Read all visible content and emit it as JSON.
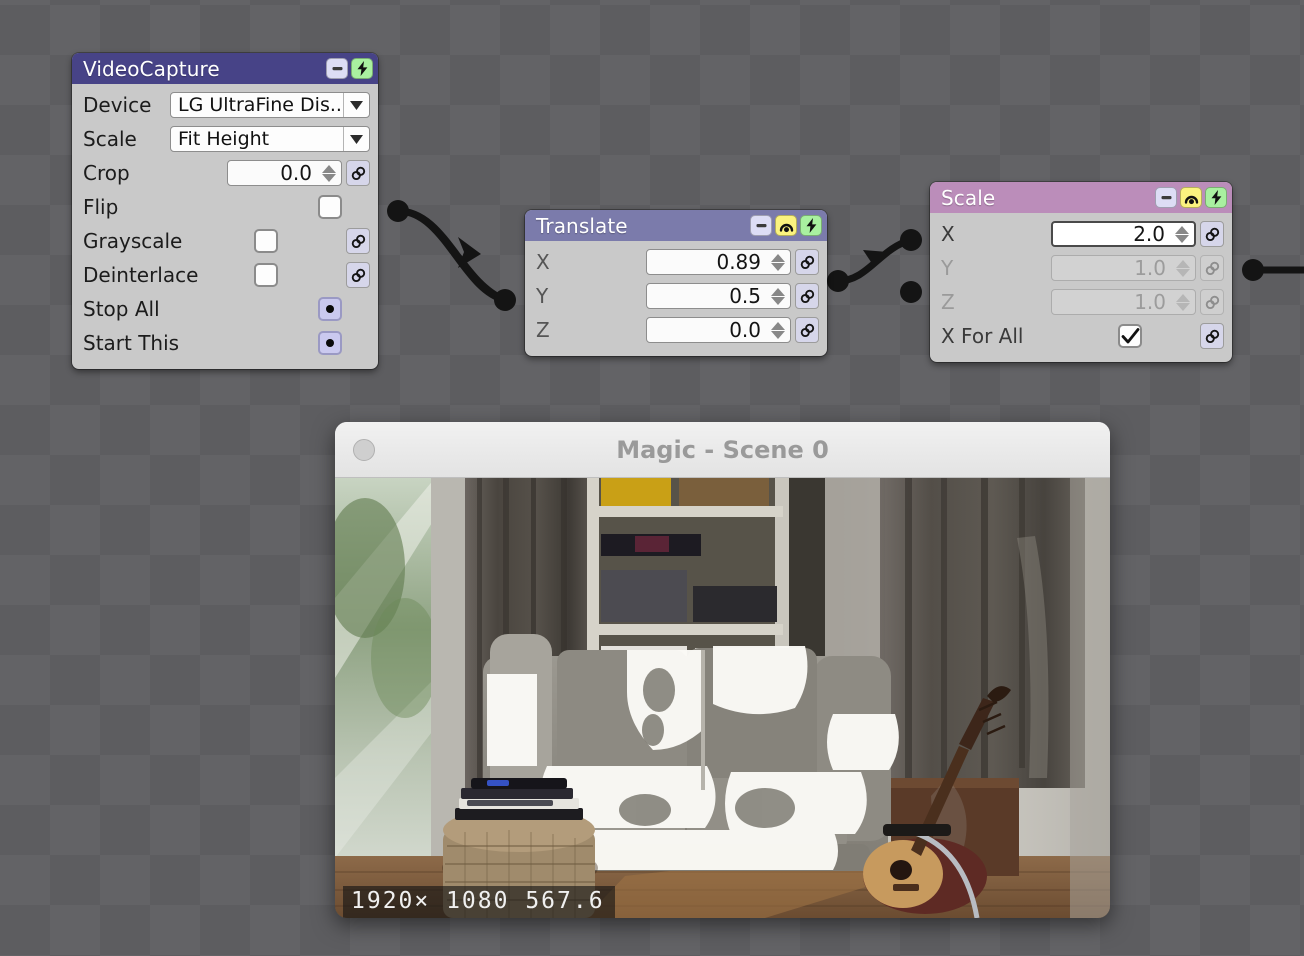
{
  "app": {
    "canvas_background": "#5d5d60",
    "checker_alt": "#636366"
  },
  "nodes": [
    {
      "id": "videocapture",
      "title": "VideoCapture",
      "header_color": "#474387",
      "header_buttons": [
        "minimize-icon",
        "bolt-icon"
      ],
      "rows": [
        {
          "label": "Device",
          "type": "combo",
          "value": "LG UltraFine Dis..."
        },
        {
          "label": "Scale",
          "type": "combo",
          "value": "Fit Height"
        },
        {
          "label": "Crop",
          "type": "number",
          "value": "0.0",
          "link": true
        },
        {
          "label": "Flip",
          "type": "checkbox",
          "checked": false,
          "link": false
        },
        {
          "label": "Grayscale",
          "type": "checkbox",
          "checked": false,
          "link": true
        },
        {
          "label": "Deinterlace",
          "type": "checkbox",
          "checked": false,
          "link": true
        },
        {
          "label": "Stop All",
          "type": "radio",
          "selected": true
        },
        {
          "label": "Start This",
          "type": "radio",
          "selected": true
        }
      ]
    },
    {
      "id": "translate",
      "title": "Translate",
      "header_color": "#7b7bab",
      "header_buttons": [
        "minimize-icon",
        "pendulum-icon",
        "bolt-icon"
      ],
      "rows": [
        {
          "label": "X",
          "type": "number",
          "value": "0.89",
          "link": true
        },
        {
          "label": "Y",
          "type": "number",
          "value": "0.5",
          "link": true
        },
        {
          "label": "Z",
          "type": "number",
          "value": "0.0",
          "link": true
        }
      ]
    },
    {
      "id": "scale",
      "title": "Scale",
      "header_color": "#bb8dba",
      "header_buttons": [
        "minimize-icon",
        "pendulum-icon",
        "bolt-icon"
      ],
      "rows": [
        {
          "label": "X",
          "type": "number",
          "value": "2.0",
          "link": true,
          "focused": true,
          "disabled": false
        },
        {
          "label": "Y",
          "type": "number",
          "value": "1.0",
          "link": true,
          "focused": false,
          "disabled": true
        },
        {
          "label": "Z",
          "type": "number",
          "value": "1.0",
          "link": true,
          "focused": false,
          "disabled": true
        },
        {
          "label": "X For All",
          "type": "checkbox",
          "checked": true,
          "link": true
        }
      ]
    }
  ],
  "preview": {
    "title": "Magic - Scene 0",
    "close_button": "close-icon",
    "status": "1920× 1080  567.6",
    "scene_description": "living room with gray sofa, wicker ottoman, bookshelf, curtained window and acoustic guitar"
  }
}
